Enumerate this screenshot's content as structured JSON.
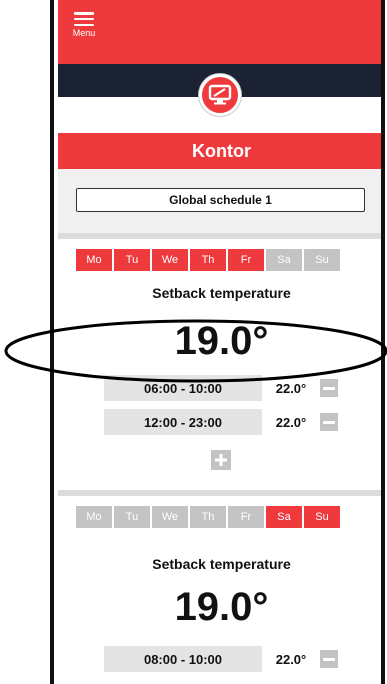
{
  "header": {
    "menu_label": "Menu",
    "room_title": "Kontor",
    "accent_color": "#ee3a3d",
    "dark_band_color": "#1b2233",
    "device_icon": "monitor-icon"
  },
  "schedule": {
    "selected": "Global schedule 1"
  },
  "sections": [
    {
      "days": [
        {
          "label": "Mo",
          "active": true
        },
        {
          "label": "Tu",
          "active": true
        },
        {
          "label": "We",
          "active": true
        },
        {
          "label": "Th",
          "active": true
        },
        {
          "label": "Fr",
          "active": true
        },
        {
          "label": "Sa",
          "active": false
        },
        {
          "label": "Su",
          "active": false
        }
      ],
      "setback_label": "Setback temperature",
      "setback_value": "19.0°",
      "slots": [
        {
          "time": "06:00 - 10:00",
          "temp": "22.0°"
        },
        {
          "time": "12:00 - 23:00",
          "temp": "22.0°"
        }
      ]
    },
    {
      "days": [
        {
          "label": "Mo",
          "active": false
        },
        {
          "label": "Tu",
          "active": false
        },
        {
          "label": "We",
          "active": false
        },
        {
          "label": "Th",
          "active": false
        },
        {
          "label": "Fr",
          "active": false
        },
        {
          "label": "Sa",
          "active": true
        },
        {
          "label": "Su",
          "active": true
        }
      ],
      "setback_label": "Setback temperature",
      "setback_value": "19.0°",
      "slots": [
        {
          "time": "08:00 - 10:00",
          "temp": "22.0°"
        }
      ]
    }
  ]
}
